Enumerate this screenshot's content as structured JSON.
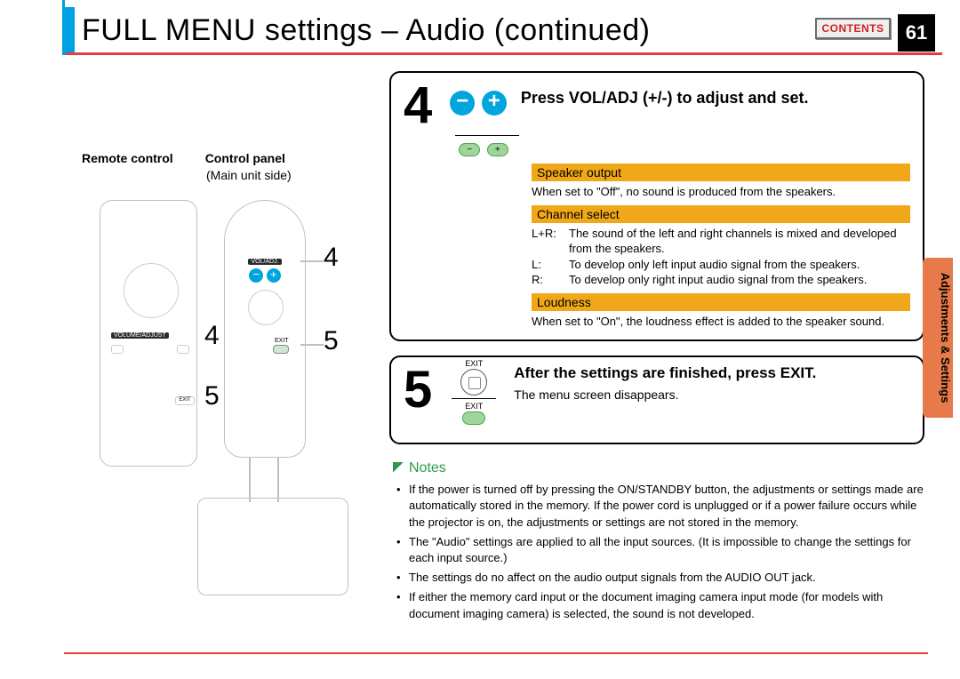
{
  "header": {
    "title": "FULL MENU settings – Audio (continued)",
    "contents_label": "CONTENTS",
    "page_number": "61",
    "side_tab": "Adjustments & Settings"
  },
  "left": {
    "remote_label": "Remote control",
    "panel_label": "Control panel",
    "panel_sub": "(Main unit side)",
    "voladj_label": "VOL/ADJ.",
    "volume_adjust_label": "VOLUME/ADJUST",
    "exit_small": "EXIT",
    "callouts": {
      "r4": "4",
      "r5": "5",
      "p4": "4",
      "p5": "5"
    }
  },
  "step4": {
    "num": "4",
    "minus": "−",
    "plus": "+",
    "title": "Press VOL/ADJ (+/-) to adjust and set.",
    "pill_minus": "−",
    "pill_plus": "+",
    "items": [
      {
        "title": "Speaker output",
        "desc": "When set to \"Off\", no sound is produced from the speakers."
      },
      {
        "title": "Channel select",
        "rows": [
          {
            "k": "L+R:",
            "v": "The sound of the left and right channels is mixed and developed from the speakers."
          },
          {
            "k": "L:",
            "v": "To develop only left input audio signal from the speakers."
          },
          {
            "k": "R:",
            "v": "To develop only right input audio signal from the speakers."
          }
        ]
      },
      {
        "title": "Loudness",
        "desc": "When set to \"On\", the loudness effect is added to the speaker sound."
      }
    ]
  },
  "step5": {
    "num": "5",
    "exit_label_top": "EXIT",
    "exit_label_bottom": "EXIT",
    "title": "After the settings are finished, press EXIT.",
    "sub": "The menu screen disappears."
  },
  "notes": {
    "title": "Notes",
    "items": [
      "If the power is turned off by pressing the ON/STANDBY button, the adjustments or settings made are automatically stored in the memory. If the power cord is unplugged or if a power failure occurs while the projector is on, the adjustments or settings are not stored in the memory.",
      "The \"Audio\" settings are applied to all the input sources.  (It is impossible to change the settings for each input source.)",
      "The settings do no affect on the audio output signals from the AUDIO OUT jack.",
      "If either the memory card input or the document imaging camera input mode (for models with document imaging camera) is selected, the sound is not developed."
    ]
  }
}
